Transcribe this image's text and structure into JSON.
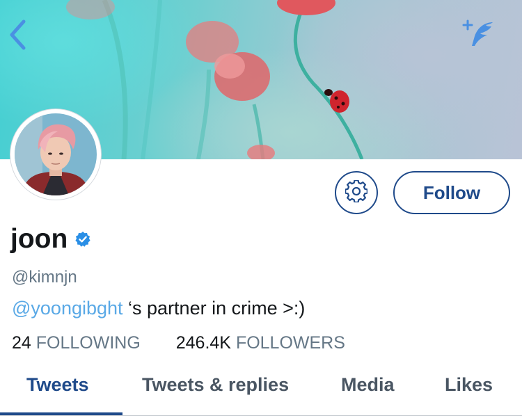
{
  "header": {
    "back_icon": "chevron-left-icon",
    "compose_icon": "feather-plus-icon",
    "icon_color": "#4a90e2"
  },
  "profile": {
    "display_name": "joon",
    "verified": true,
    "verified_icon": "verified-badge-icon",
    "handle": "@kimnjn",
    "bio_mention": "@yoongibght",
    "bio_text": " ‘s partner in crime >:)"
  },
  "actions": {
    "settings_icon": "gear-icon",
    "follow_label": "Follow"
  },
  "stats": {
    "following_count": "24",
    "following_label": "FOLLOWING",
    "followers_count": "246.4K",
    "followers_label": "FOLLOWERS"
  },
  "tabs": [
    {
      "label": "Tweets",
      "active": true
    },
    {
      "label": "Tweets & replies",
      "active": false
    },
    {
      "label": "Media",
      "active": false
    },
    {
      "label": "Likes",
      "active": false
    }
  ],
  "colors": {
    "accent": "#1f4a8a",
    "link": "#5aa9e6",
    "verified": "#2a8fe6",
    "secondary_text": "#657786"
  }
}
